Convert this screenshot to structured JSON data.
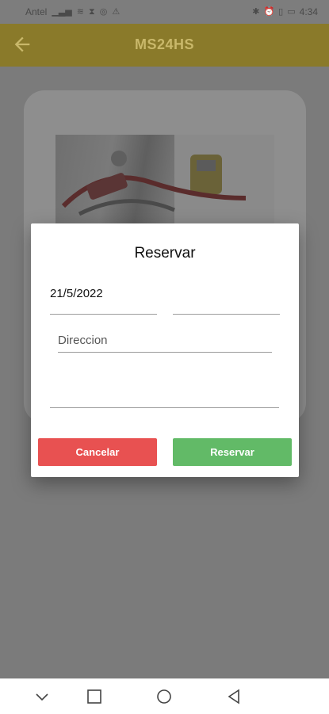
{
  "status_bar": {
    "carrier": "Antel",
    "time": "4:34"
  },
  "app_bar": {
    "title": "MS24HS",
    "back_icon": "arrow-left-icon"
  },
  "dialog": {
    "title": "Reservar",
    "date_value": "21/5/2022",
    "time_value": "",
    "address_placeholder": "Direccion",
    "address_value": "",
    "notes_value": "",
    "cancel_label": "Cancelar",
    "reserve_label": "Reservar"
  },
  "colors": {
    "cancel": "#e85151",
    "reserve": "#62ba67",
    "app_bar_dimmed": "#8a7a2a"
  },
  "nav_bar": {
    "items": [
      "chevron-down-icon",
      "square-icon",
      "circle-icon",
      "triangle-back-icon"
    ]
  }
}
